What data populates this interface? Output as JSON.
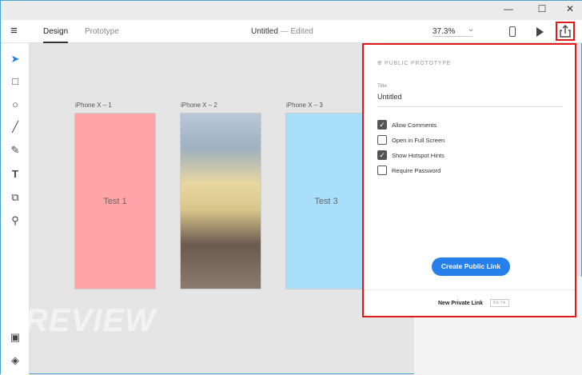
{
  "window": {
    "minimize": "—",
    "maximize": "☐",
    "close": "✕"
  },
  "topbar": {
    "tabs": [
      {
        "label": "Design"
      },
      {
        "label": "Prototype"
      }
    ],
    "doc_title": "Untitled",
    "separator": "—",
    "doc_status": "Edited",
    "zoom": "37.3%",
    "zoom_chevron": "⌄"
  },
  "artboards": [
    {
      "label": "iPhone X – 1",
      "text": "Test 1",
      "color": "#ffa5a8"
    },
    {
      "label": "iPhone X – 2",
      "text": ""
    },
    {
      "label": "iPhone X – 3",
      "text": "Test 3",
      "color": "#a9dffb"
    }
  ],
  "panel": {
    "heading": "PUBLIC PROTOTYPE",
    "title_label": "Title",
    "title_value": "Untitled",
    "options": [
      {
        "label": "Allow Comments",
        "checked": true
      },
      {
        "label": "Open in Full Screen",
        "checked": false
      },
      {
        "label": "Show Hotspot Hints",
        "checked": true
      },
      {
        "label": "Require Password",
        "checked": false
      }
    ],
    "create_button": "Create Public Link",
    "private_link": "New Private Link",
    "beta": "BETA"
  },
  "watermark": "THAIWARE REVIEW",
  "colors": {
    "accent": "#2680eb",
    "highlight": "#e01818"
  }
}
